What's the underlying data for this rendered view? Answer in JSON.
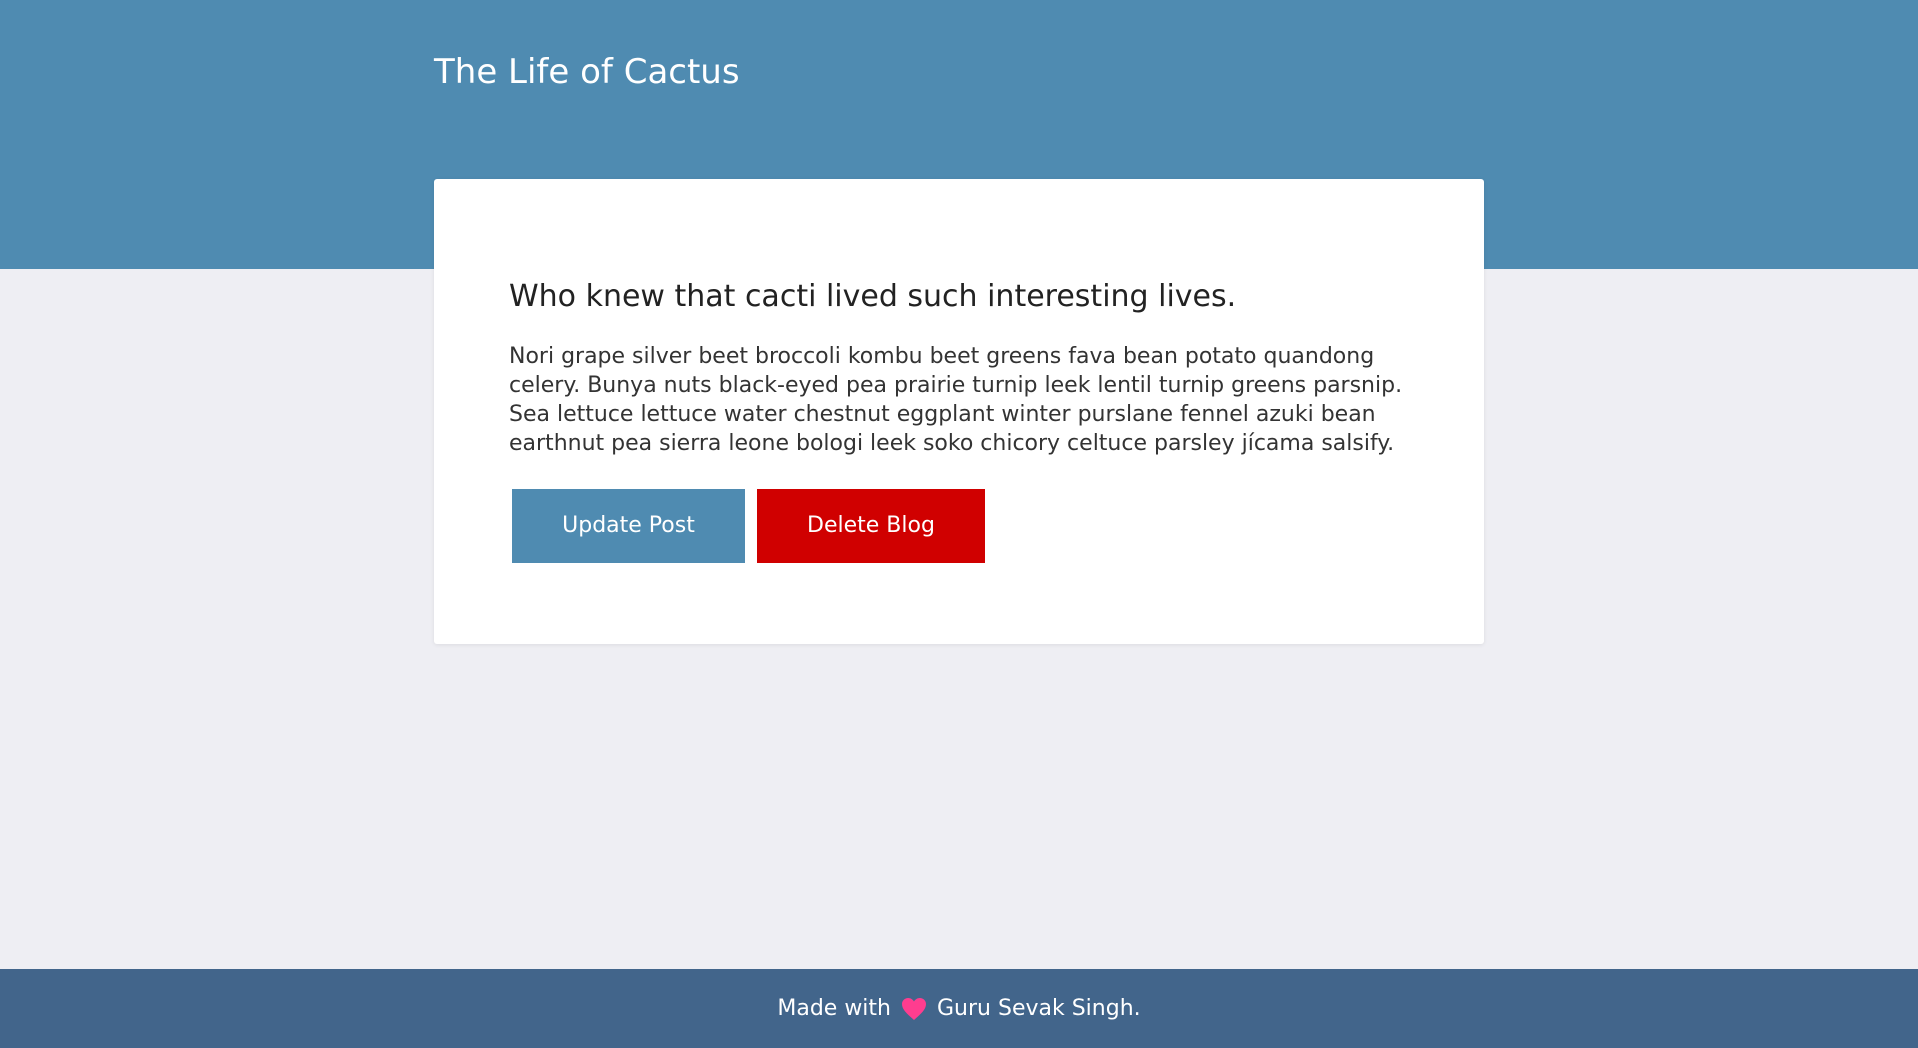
{
  "header": {
    "site_title": "The Life of Cactus"
  },
  "post": {
    "title": "Who knew that cacti lived such interesting lives.",
    "body": "Nori grape silver beet broccoli kombu beet greens fava bean potato quandong celery. Bunya nuts black-eyed pea prairie turnip leek lentil turnip greens parsnip. Sea lettuce lettuce water chestnut eggplant winter purslane fennel azuki bean earthnut pea sierra leone bologi leek soko chicory celtuce parsley jícama salsify.",
    "update_label": "Update Post",
    "delete_label": "Delete Blog"
  },
  "footer": {
    "made_with": "Made with",
    "heart_icon": "heart-icon",
    "author": "Guru Sevak Singh."
  },
  "colors": {
    "header_bg": "#4f8bb1",
    "page_bg": "#eeeef3",
    "update_button": "#4f8bb1",
    "delete_button": "#d00000",
    "footer_bg": "#42658b",
    "heart": "#ff3d8f"
  }
}
